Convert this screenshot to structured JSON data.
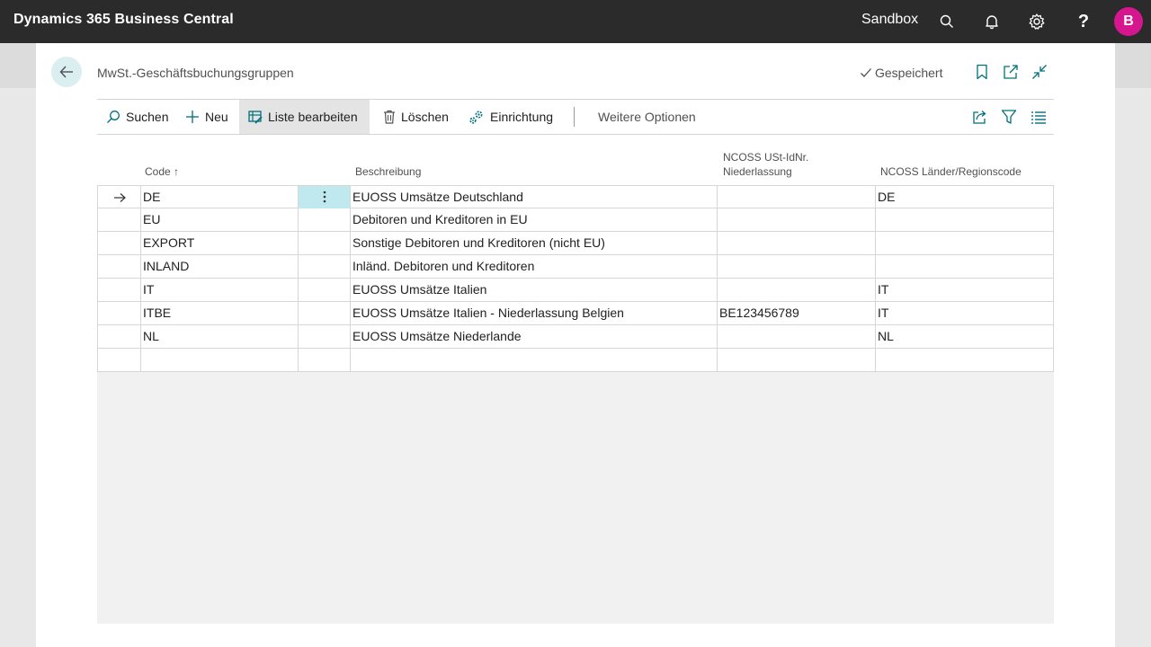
{
  "app": {
    "title": "Dynamics 365 Business Central",
    "environment": "Sandbox",
    "avatar_initial": "B",
    "avatar_color": "#d6168e"
  },
  "topbar_icons": [
    "search-icon",
    "bell-icon",
    "gear-icon",
    "help-icon"
  ],
  "page": {
    "title": "MwSt.-Geschäftsbuchungsgruppen",
    "saved_status": "Gespeichert"
  },
  "actions": {
    "search": "Suchen",
    "new": "Neu",
    "edit_list": "Liste bearbeiten",
    "delete": "Löschen",
    "setup": "Einrichtung",
    "more": "Weitere Optionen"
  },
  "columns": {
    "code": "Code",
    "sort_indicator": "↑",
    "description": "Beschreibung",
    "vat_id_line1": "NCOSS USt-IdNr.",
    "vat_id_line2": "Niederlassung",
    "country": "NCOSS Länder/Regionscode"
  },
  "rows": [
    {
      "code": "DE",
      "description": "EUOSS Umsätze Deutschland",
      "vat_id": "",
      "country": "DE"
    },
    {
      "code": "EU",
      "description": "Debitoren und Kreditoren in EU",
      "vat_id": "",
      "country": ""
    },
    {
      "code": "EXPORT",
      "description": "Sonstige Debitoren und Kreditoren (nicht EU)",
      "vat_id": "",
      "country": ""
    },
    {
      "code": "INLAND",
      "description": "Inländ. Debitoren und Kreditoren",
      "vat_id": "",
      "country": ""
    },
    {
      "code": "IT",
      "description": "EUOSS Umsätze Italien",
      "vat_id": "",
      "country": "IT"
    },
    {
      "code": "ITBE",
      "description": "EUOSS Umsätze Italien - Niederlassung Belgien",
      "vat_id": "BE123456789",
      "country": "IT"
    },
    {
      "code": "NL",
      "description": "EUOSS Umsätze Niederlande",
      "vat_id": "",
      "country": "NL"
    },
    {
      "code": "",
      "description": "",
      "vat_id": "",
      "country": ""
    }
  ],
  "selected_row_index": 0,
  "colors": {
    "accent": "#008489",
    "topbar_bg": "#2b2b2b",
    "selected_cell_bg": "#bfe9ee"
  }
}
